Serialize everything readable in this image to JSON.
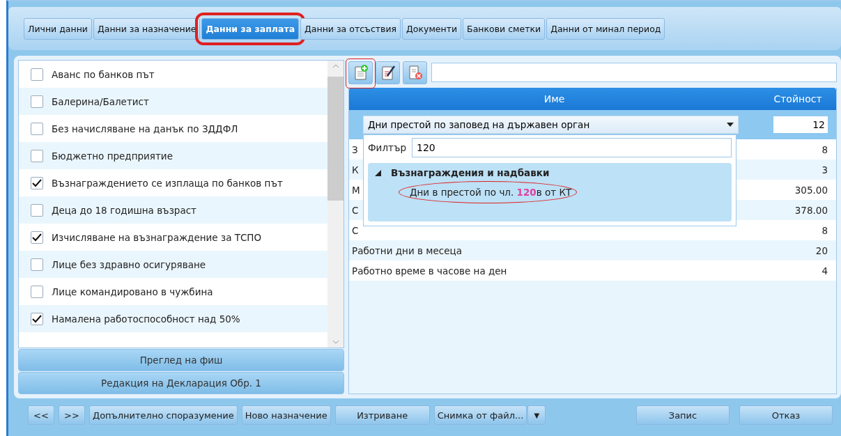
{
  "tabs": [
    {
      "label": "Лични данни",
      "selected": false,
      "highlighted": false
    },
    {
      "label": "Данни за назначение",
      "selected": false,
      "highlighted": false
    },
    {
      "label": "Данни за заплата",
      "selected": true,
      "highlighted": true
    },
    {
      "label": "Данни за отсъствия",
      "selected": false,
      "highlighted": false
    },
    {
      "label": "Документи",
      "selected": false,
      "highlighted": false
    },
    {
      "label": "Банкови сметки",
      "selected": false,
      "highlighted": false
    },
    {
      "label": "Данни от минал период",
      "selected": false,
      "highlighted": false
    }
  ],
  "options": [
    {
      "label": "Аванс по банков път",
      "checked": false
    },
    {
      "label": "Балерина/Балетист",
      "checked": false
    },
    {
      "label": "Без начисляване на данък по ЗДДФЛ",
      "checked": false
    },
    {
      "label": "Бюджетно предприятие",
      "checked": false
    },
    {
      "label": "Възнаграждението се изплаща по банков път",
      "checked": true
    },
    {
      "label": "Деца до 18 годишна възраст",
      "checked": false
    },
    {
      "label": "Изчисляване на възнаграждение за ТСПО",
      "checked": true
    },
    {
      "label": "Лице без здравно осигуряване",
      "checked": false
    },
    {
      "label": "Лице командировано в чужбина",
      "checked": false
    },
    {
      "label": "Намалена работоспособност над 50%",
      "checked": true
    }
  ],
  "side_buttons": [
    "Преглед на фиш",
    "Редакция на Декларация Обр. 1"
  ],
  "toolbar": {
    "buttons": [
      {
        "kind": "add",
        "highlighted": true
      },
      {
        "kind": "edit",
        "highlighted": false
      },
      {
        "kind": "delete",
        "highlighted": false
      }
    ]
  },
  "table": {
    "columns": [
      "Име",
      "Стойност"
    ],
    "edit_row": {
      "name": "Дни престой по заповед на държавен орган",
      "value": "12"
    },
    "rows": [
      {
        "name": "З",
        "value": "8"
      },
      {
        "name": "К",
        "value": "3"
      },
      {
        "name": "М",
        "value": "305.00"
      },
      {
        "name": "С",
        "value": "378.00"
      },
      {
        "name": "С",
        "value": "8"
      },
      {
        "name": "Работни дни в месеца",
        "value": "20"
      },
      {
        "name": "Работно време в часове на ден",
        "value": "4"
      }
    ]
  },
  "dropdown": {
    "filter_label": "Филтър",
    "filter_value": "120",
    "group": {
      "label": "Възнаграждения и надбавки",
      "expanded": true,
      "children": [
        {
          "label": "Дни в престой по чл. **120**в от КТ",
          "highlighted": true
        }
      ]
    }
  },
  "footer": {
    "left": [
      "<<",
      ">>",
      "Допълнително споразумение",
      "Ново назначение",
      "Изтриване"
    ],
    "split": {
      "label": "Снимка от файл...",
      "arrow": "▼"
    },
    "right": [
      "Запис",
      "Отказ"
    ]
  }
}
